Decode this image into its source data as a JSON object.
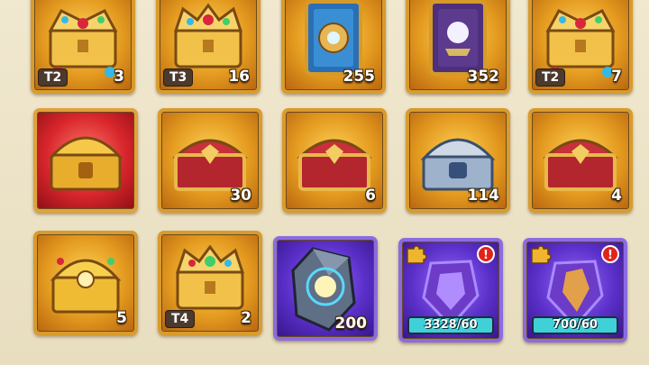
{
  "inventory": {
    "items": [
      {
        "id": "r1c1",
        "name": "Tiered Crown Chest",
        "tier": "T2",
        "count": "3",
        "rarity": "gold",
        "icon": "crown-chest-icon"
      },
      {
        "id": "r1c2",
        "name": "Tiered Crown Chest",
        "tier": "T3",
        "count": "16",
        "rarity": "gold",
        "icon": "crown-chest-icon"
      },
      {
        "id": "r1c3",
        "name": "Blue Summon Card",
        "tier": "",
        "count": "255",
        "rarity": "gold",
        "icon": "blue-card-icon"
      },
      {
        "id": "r1c4",
        "name": "Purple Orb Card",
        "tier": "",
        "count": "352",
        "rarity": "gold",
        "icon": "purple-card-icon"
      },
      {
        "id": "r1c5",
        "name": "Tiered Crown Chest",
        "tier": "T2",
        "count": "7",
        "rarity": "gold",
        "icon": "crown-chest-icon"
      },
      {
        "id": "r2c1",
        "name": "Golden Treasure Chest",
        "tier": "",
        "count": "",
        "rarity": "red",
        "icon": "golden-chest-icon"
      },
      {
        "id": "r2c2",
        "name": "Ruby Chest",
        "tier": "",
        "count": "30",
        "rarity": "gold",
        "icon": "ruby-chest-icon"
      },
      {
        "id": "r2c3",
        "name": "Ruby Chest",
        "tier": "",
        "count": "6",
        "rarity": "gold",
        "icon": "ruby-chest-icon"
      },
      {
        "id": "r2c4",
        "name": "Silver Chest",
        "tier": "",
        "count": "114",
        "rarity": "gold",
        "icon": "silver-chest-icon"
      },
      {
        "id": "r2c5",
        "name": "Ruby Chest",
        "tier": "",
        "count": "4",
        "rarity": "gold",
        "icon": "ruby-chest-icon"
      },
      {
        "id": "r3c1",
        "name": "Ornate Gold Chest",
        "tier": "",
        "count": "5",
        "rarity": "gold",
        "icon": "ornate-chest-icon"
      },
      {
        "id": "r3c2",
        "name": "Tiered Crown Chest",
        "tier": "T4",
        "count": "2",
        "rarity": "gold",
        "icon": "crown-chest-icon"
      },
      {
        "id": "r3c3",
        "name": "Crystal Stone",
        "tier": "",
        "count": "200",
        "rarity": "purple",
        "icon": "crystal-stone-icon"
      },
      {
        "id": "r3c4",
        "name": "Hero Shard",
        "tier": "",
        "count": "",
        "rarity": "purple",
        "icon": "shard-icon",
        "progress_text": "3328/60",
        "progress_fraction": 1.0,
        "has_alert": true,
        "alert": "!",
        "is_fragment": true
      },
      {
        "id": "r3c5",
        "name": "Hero Shard",
        "tier": "",
        "count": "",
        "rarity": "purple",
        "icon": "shard-icon",
        "progress_text": "700/60",
        "progress_fraction": 1.0,
        "has_alert": true,
        "alert": "!",
        "is_fragment": true
      }
    ]
  },
  "colors": {
    "gold_frame": "#d99b2c",
    "red_frame": "#d8262c",
    "purple_frame": "#5a2fc8",
    "progress_fill": "#3fd0d8",
    "alert": "#e2231a"
  }
}
